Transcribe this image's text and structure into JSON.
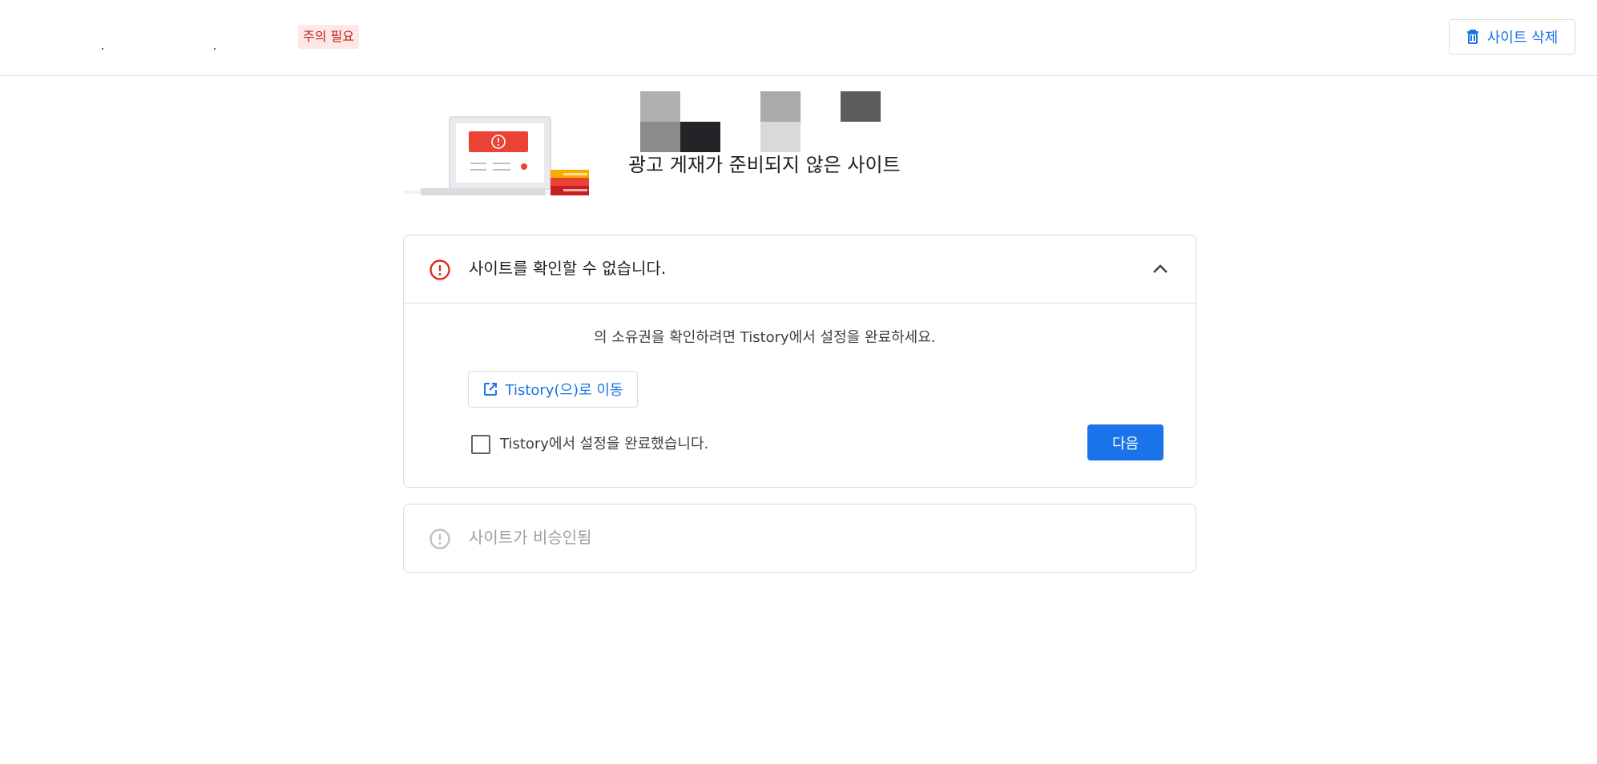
{
  "header": {
    "status_badge": "주의 필요",
    "delete_button_label": "사이트 삭제"
  },
  "hero": {
    "title": "광고 게재가 준비되지 않은 사이트"
  },
  "verify_card": {
    "title": "사이트를 확인할 수 없습니다.",
    "instruction": "의 소유권을 확인하려면 Tistory에서 설정을 완료하세요.",
    "goto_button_label": "Tistory(으)로 이동",
    "checkbox_label": "Tistory에서 설정을 완료했습니다.",
    "checkbox_checked": false,
    "next_button_label": "다음"
  },
  "approval_card": {
    "title": "사이트가 비승인됨"
  },
  "colors": {
    "accent": "#1a73e8",
    "error": "#d93025",
    "badge_bg": "#fce8e6",
    "badge_text": "#c5221f",
    "disabled": "#9aa0a6"
  },
  "icons": {
    "delete": "trash-icon",
    "error": "error-circle-icon",
    "collapse": "chevron-up-icon",
    "external": "open-in-new-icon"
  }
}
